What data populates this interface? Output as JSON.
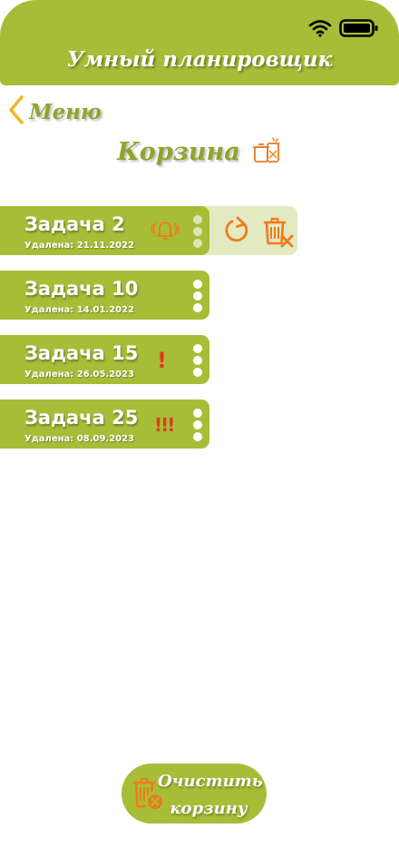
{
  "status_bar": {
    "wifi_icon": "wifi-icon",
    "battery_icon": "battery-icon"
  },
  "header": {
    "title": "Умный планировщик"
  },
  "nav": {
    "back_label": "Меню",
    "back_icon": "chevron-left-icon"
  },
  "page": {
    "title": "Корзина",
    "title_icon": "trash-bin-icon"
  },
  "tasks": [
    {
      "name": "Задача 2",
      "deleted": "Удалена: 21.11.2022",
      "status_icon": "bell-icon",
      "status_text": ""
    },
    {
      "name": "Задача 10",
      "deleted": "Удалена: 14.01.2022",
      "status_icon": "",
      "status_text": ""
    },
    {
      "name": "Задача 15",
      "deleted": "Удалена: 26.05.2023",
      "status_icon": "priority-icon",
      "status_text": "!"
    },
    {
      "name": "Задача 25",
      "deleted": "Удалена: 08.09.2023",
      "status_icon": "priority-icon",
      "status_text": "!!!"
    }
  ],
  "swipe_actions": {
    "restore_icon": "restore-icon",
    "delete_icon": "delete-forever-icon"
  },
  "footer": {
    "clear_label": "Очистить корзину",
    "clear_icon": "trash-delete-icon"
  },
  "colors": {
    "accent": "#a7bd38",
    "title_text": "#8ea62b",
    "action_orange": "#f07a1a",
    "priority_red": "#e23b1c",
    "swipe_bg": "#e3e9c1",
    "back_arrow": "#f2b628"
  }
}
